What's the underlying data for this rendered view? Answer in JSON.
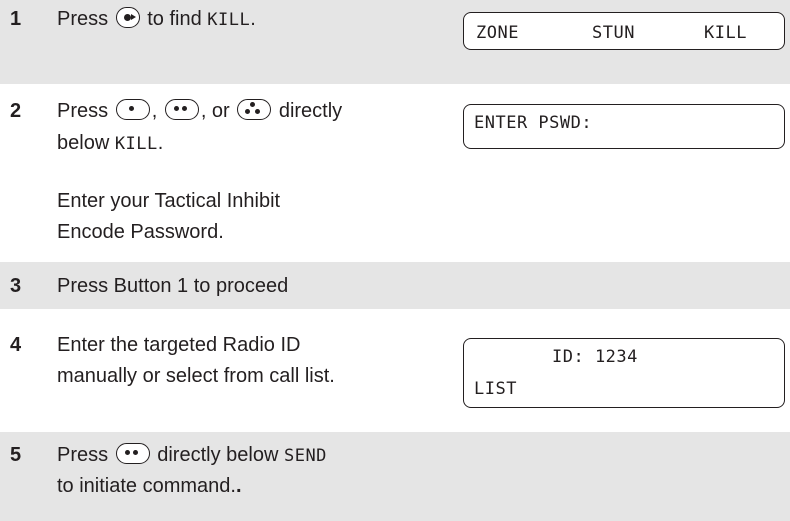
{
  "steps": [
    {
      "number": "1",
      "parts": {
        "a": "Press ",
        "b": " to find ",
        "c": "KILL",
        "d": "."
      }
    },
    {
      "number": "2",
      "parts": {
        "a": "Press ",
        "b": ", ",
        "c": ", or ",
        "d": " directly",
        "e": "below ",
        "f": "KILL",
        "g": "."
      },
      "extra_line1": "Enter your Tactical Inhibit",
      "extra_line2": "Encode Password."
    },
    {
      "number": "3",
      "text": "Press Button 1 to proceed"
    },
    {
      "number": "4",
      "line1": "Enter the targeted Radio ID",
      "line2": "manually or select from call list."
    },
    {
      "number": "5",
      "parts": {
        "a": "Press ",
        "b": " directly below ",
        "c": "SEND",
        "d": "to initiate command.",
        "e": "."
      }
    }
  ],
  "displays": {
    "d1": {
      "softkeys": [
        "ZONE",
        "STUN",
        "KILL"
      ]
    },
    "d2": {
      "line1": "ENTER PSWD:"
    },
    "d3": {
      "line1": "ID: 1234",
      "line2": "LIST"
    }
  },
  "icons": {
    "nav_right": "nav-right-button",
    "one_dot": "one-dot-button",
    "two_dot": "two-dot-button",
    "three_dot": "three-dot-button"
  },
  "colors": {
    "band": "#e5e5e5",
    "text": "#231f20"
  }
}
